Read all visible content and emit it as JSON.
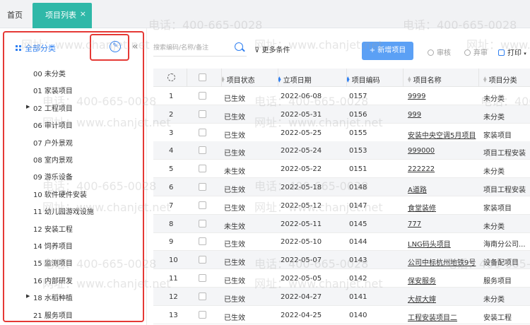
{
  "tabs": {
    "home": "首页",
    "active": "项目列表",
    "close": "×"
  },
  "sidebar": {
    "title": "全部分类",
    "items": [
      {
        "label": "00 未分类",
        "arrow": ""
      },
      {
        "label": "01 家装项目",
        "arrow": ""
      },
      {
        "label": "02 工程项目",
        "arrow": "▶"
      },
      {
        "label": "06 审计项目",
        "arrow": ""
      },
      {
        "label": "07 户外景观",
        "arrow": ""
      },
      {
        "label": "08 室内景观",
        "arrow": ""
      },
      {
        "label": "09 游乐设备",
        "arrow": ""
      },
      {
        "label": "10 软件硬件安装",
        "arrow": ""
      },
      {
        "label": "11 幼儿园游戏设施",
        "arrow": ""
      },
      {
        "label": "12 安装工程",
        "arrow": ""
      },
      {
        "label": "14 饲养项目",
        "arrow": ""
      },
      {
        "label": "15 监测项目",
        "arrow": ""
      },
      {
        "label": "16 内部研发",
        "arrow": ""
      },
      {
        "label": "18 水稻种植",
        "arrow": "▶"
      },
      {
        "label": "21 服务项目",
        "arrow": ""
      }
    ],
    "collapse": "«"
  },
  "toolbar": {
    "search_placeholder": "搜索编码/名称/备注",
    "more_filter": "更多条件",
    "add_button": "+ 新增项目",
    "audit": "审核",
    "abandon": "弃审",
    "print": "打印"
  },
  "table": {
    "headers": [
      "项目状态",
      "立项日期",
      "项目编码",
      "项目名称",
      "项目分类"
    ],
    "rows": [
      {
        "no": "1",
        "status": "已生效",
        "date": "2022-06-08",
        "code": "0157",
        "name": "9999",
        "category": "未分类"
      },
      {
        "no": "2",
        "status": "已生效",
        "date": "2022-05-31",
        "code": "0156",
        "name": "999",
        "category": "未分类"
      },
      {
        "no": "3",
        "status": "已生效",
        "date": "2022-05-25",
        "code": "0155",
        "name": "安装中央空调5月项目",
        "category": "家装项目"
      },
      {
        "no": "4",
        "status": "已生效",
        "date": "2022-05-24",
        "code": "0153",
        "name": "999000",
        "category": "项目工程安装"
      },
      {
        "no": "5",
        "status": "未生效",
        "date": "2022-05-22",
        "code": "0151",
        "name": "222222",
        "category": "未分类"
      },
      {
        "no": "6",
        "status": "已生效",
        "date": "2022-05-18",
        "code": "0148",
        "name": "A道路",
        "category": "项目工程安装"
      },
      {
        "no": "7",
        "status": "已生效",
        "date": "2022-05-12",
        "code": "0147",
        "name": "食堂装修",
        "category": "家装项目"
      },
      {
        "no": "8",
        "status": "未生效",
        "date": "2022-05-11",
        "code": "0145",
        "name": "777",
        "category": "未分类"
      },
      {
        "no": "9",
        "status": "已生效",
        "date": "2022-05-10",
        "code": "0144",
        "name": "LNG码头项目",
        "category": "海南分公司..."
      },
      {
        "no": "10",
        "status": "已生效",
        "date": "2022-05-07",
        "code": "0143",
        "name": "公司中标杭州地铁9号",
        "category": "设备配项目"
      },
      {
        "no": "11",
        "status": "已生效",
        "date": "2022-05-05",
        "code": "0142",
        "name": "保安服务",
        "category": "服务项目"
      },
      {
        "no": "12",
        "status": "已生效",
        "date": "2022-04-27",
        "code": "0141",
        "name": "大叔大婶",
        "category": "未分类"
      },
      {
        "no": "13",
        "status": "已生效",
        "date": "2022-04-25",
        "code": "0140",
        "name": "工程安装项目二",
        "category": "安装工程"
      }
    ]
  },
  "watermark": {
    "phone": "电话：400-665-0028",
    "site": "网址：www.chanjet.net"
  }
}
